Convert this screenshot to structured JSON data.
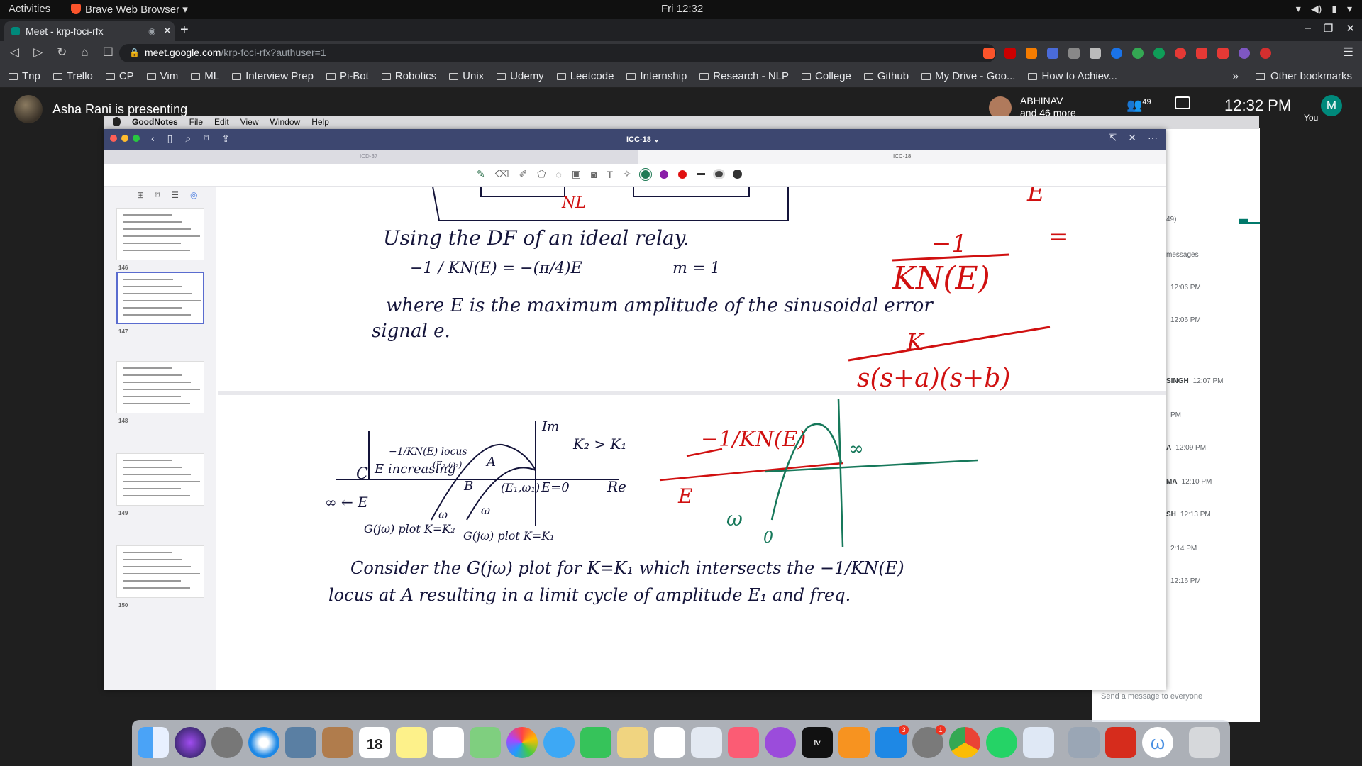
{
  "topbar": {
    "activities": "Activities",
    "app_name": "Brave Web Browser ▾",
    "clock": "Fri 12:32"
  },
  "browser": {
    "tab_title": "Meet - krp-foci-rfx",
    "url_domain": "meet.google.com",
    "url_path": "/krp-foci-rfx?authuser=1",
    "bookmarks": [
      "Tnp",
      "Trello",
      "CP",
      "Vim",
      "ML",
      "Interview Prep",
      "Pi-Bot",
      "Robotics",
      "Unix",
      "Udemy",
      "Leetcode",
      "Internship",
      "Research - NLP",
      "College",
      "Github",
      "My Drive - Goo...",
      "How to Achiev..."
    ],
    "other_bookmarks": "Other bookmarks",
    "overflow": "»"
  },
  "meet": {
    "presenter_text": "Asha Rani is presenting",
    "participant_name": "ABHINAV",
    "participant_more": "and 46 more",
    "people_count": "49",
    "clock": "12:32 PM",
    "you_initial": "M",
    "you_label": "You",
    "chat": {
      "count_label": "49)",
      "messages_label": "messages",
      "rows": [
        {
          "name": "",
          "time": "12:06 PM"
        },
        {
          "name": "",
          "time": "12:06 PM"
        },
        {
          "name": "SINGH",
          "time": "12:07 PM"
        },
        {
          "name": "",
          "time": "PM"
        },
        {
          "name": "A",
          "time": "12:09 PM"
        },
        {
          "name": "MA",
          "time": "12:10 PM"
        },
        {
          "name": "SH",
          "time": "12:13 PM"
        },
        {
          "name": "",
          "time": "2:14 PM"
        },
        {
          "name": "",
          "time": "12:16 PM"
        }
      ],
      "input_placeholder": "Send a message to everyone"
    }
  },
  "mac": {
    "app": "GoodNotes",
    "menus": [
      "File",
      "Edit",
      "View",
      "Window",
      "Help"
    ]
  },
  "goodnotes": {
    "doc_title": "ICC-18 ⌄",
    "tab_left": "ICD-37",
    "tab_right": "ICC-18",
    "pages": [
      "146",
      "147",
      "148",
      "149",
      "150"
    ],
    "notes": {
      "top": {
        "nl_label": "NL",
        "line1": "Using the DF of an ideal relay.",
        "frac_neg": "−1 / KN(E) = −(π/4)E",
        "m_eq": "m = 1",
        "line2a": "where E is the maximum amplitude of the sinusoidal error",
        "line2b": "signal e.",
        "red_E": "E",
        "red_frac_num": "−1",
        "red_frac_den": "KN(E)",
        "red_eq": "=",
        "red_tf_num": "K",
        "red_tf_den": "s(s+a)(s+b)"
      },
      "bottom": {
        "locus_title": "−1/KN(E) locus",
        "e_increasing": "E increasing",
        "eb_label": "(E₂,ω₂)",
        "c_label": "C",
        "a_label": "A",
        "b_label": "B",
        "e1_label": "(E₁,ω₁)",
        "e0_label": "E=0",
        "im_label": "Im",
        "re_label": "Re",
        "k_ineq": "K₂ > K₁",
        "inf_label": "∞ ← E",
        "plot_k2": "G(jω) plot K=K₂",
        "plot_k1": "G(jω) plot K=K₁",
        "omega_a": "ω",
        "omega_b": "ω",
        "red_locus": "−1/KN(E)",
        "red_E": "E",
        "green_inf": "∞",
        "green_w": "ω",
        "green_0": "0",
        "line3a": "Consider the G(jω) plot for K=K₁ which intersects the −1/KN(E)",
        "line3b": "locus at A resulting in a limit cycle of amplitude E₁ and freq."
      }
    }
  }
}
